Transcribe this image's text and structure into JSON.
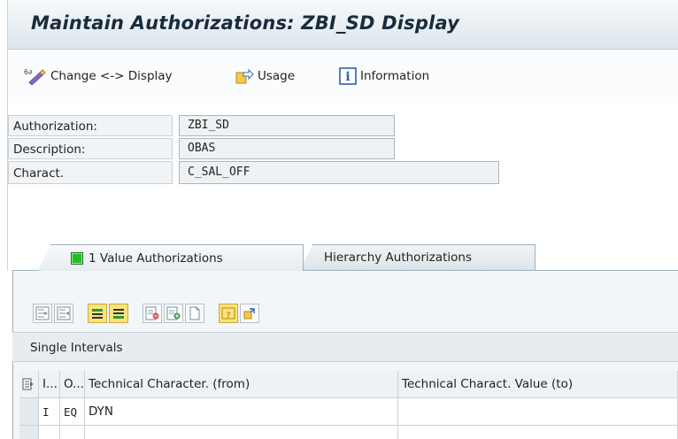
{
  "window": {
    "title": "Maintain Authorizations: ZBI_SD Display"
  },
  "toolbar": {
    "change_display": "Change <-> Display",
    "usage": "Usage",
    "information": "Information"
  },
  "form": {
    "authorization_label": "Authorization:",
    "authorization_value": "ZBI_SD",
    "description_label": "Description:",
    "description_value": "OBAS",
    "charact_label": "Charact.",
    "charact_value": "C_SAL_OFF"
  },
  "tabs": [
    {
      "label": "1  Value Authorizations",
      "active": true
    },
    {
      "label": "Hierarchy Authorizations",
      "active": false
    }
  ],
  "section": {
    "title": "Single Intervals"
  },
  "grid": {
    "headers": [
      "I...",
      "O...",
      "Technical Character. (from)",
      "Technical Charact. Value (to)"
    ],
    "rows": [
      {
        "i": "I",
        "o": "EQ",
        "from": "DYN",
        "to": ""
      }
    ]
  },
  "colors": {
    "accent_green": "#20c020",
    "title_text": "#1a2b3c"
  },
  "icons": [
    "change-display-icon",
    "usage-icon",
    "information-icon"
  ]
}
